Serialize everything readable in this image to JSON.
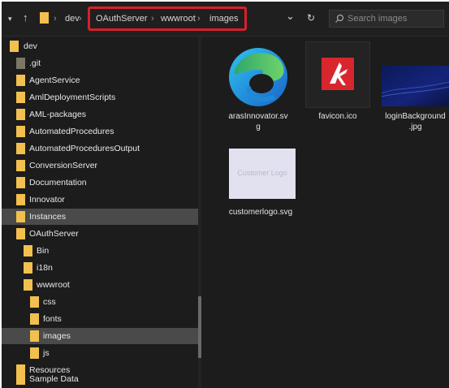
{
  "window": {
    "title": "images"
  },
  "addressbar": {
    "back_glyph": "▾",
    "up_glyph": "↑",
    "path": [
      "dev",
      "OAuthServer",
      "wwwroot",
      "images"
    ],
    "separator": "›",
    "dropdown_glyph": "⌄",
    "refresh_glyph": "↻"
  },
  "search": {
    "placeholder": "Search images",
    "value": ""
  },
  "sidebar": {
    "items": [
      {
        "label": "dev",
        "icon": "folder-icon",
        "selected": false
      },
      {
        "label": ".git",
        "icon": "folder-icon",
        "selected": false
      },
      {
        "label": "AgentService",
        "icon": "folder-icon",
        "selected": false
      },
      {
        "label": "AmlDeploymentScripts",
        "icon": "folder-icon",
        "selected": false
      },
      {
        "label": "AML-packages",
        "icon": "folder-icon",
        "selected": false
      },
      {
        "label": "AutomatedProcedures",
        "icon": "folder-icon",
        "selected": false
      },
      {
        "label": "AutomatedProceduresOutput",
        "icon": "folder-icon",
        "selected": false
      },
      {
        "label": "ConversionServer",
        "icon": "folder-icon",
        "selected": false
      },
      {
        "label": "Documentation",
        "icon": "folder-icon",
        "selected": false
      },
      {
        "label": "Innovator",
        "icon": "folder-icon",
        "selected": false
      },
      {
        "label": "Instances",
        "icon": "folder-icon",
        "selected": true
      },
      {
        "label": "OAuthServer",
        "icon": "folder-icon",
        "selected": false
      },
      {
        "label": "Bin",
        "icon": "folder-icon",
        "selected": false
      },
      {
        "label": "i18n",
        "icon": "folder-icon",
        "selected": false
      },
      {
        "label": "wwwroot",
        "icon": "folder-icon",
        "selected": false
      },
      {
        "label": "css",
        "icon": "folder-icon",
        "selected": false
      },
      {
        "label": "fonts",
        "icon": "folder-icon",
        "selected": false
      },
      {
        "label": "images",
        "icon": "folder-icon",
        "selected": true
      },
      {
        "label": "js",
        "icon": "folder-icon",
        "selected": false
      },
      {
        "label": "Resources",
        "icon": "folder-icon",
        "selected": false
      },
      {
        "label": "Sample Data",
        "icon": "folder-icon",
        "selected": false
      }
    ]
  },
  "files": [
    {
      "name_line1": "arasInnovator.sv",
      "name_line2": "g",
      "icon": "edge-browser-icon"
    },
    {
      "name_line1": "favicon.ico",
      "name_line2": "",
      "icon": "aras-logo-icon"
    },
    {
      "name_line1": "loginBackground",
      "name_line2": ".jpg",
      "icon": "image-thumbnail"
    },
    {
      "name_line1": "customerlogo.svg",
      "name_line2": "",
      "icon": "image-thumbnail",
      "thumb_text": "Customer Logo"
    }
  ],
  "colors": {
    "accent_red": "#d6202a",
    "folder": "#f2c04e",
    "selected_bg": "#4a4a4a",
    "background": "#1c1c1c"
  }
}
